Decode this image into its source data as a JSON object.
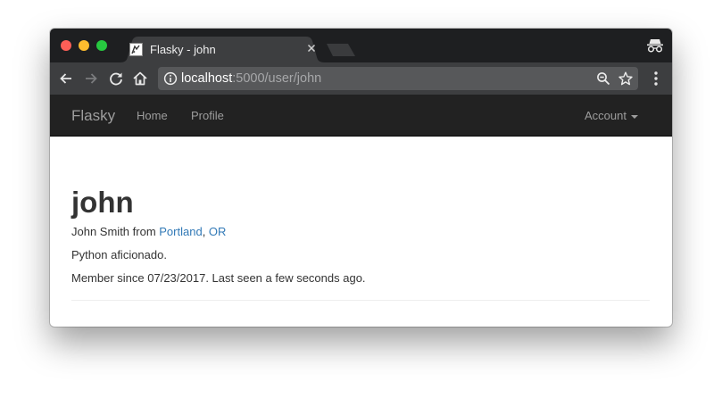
{
  "browser": {
    "tab_title": "Flasky - john",
    "url_host": "localhost",
    "url_rest": ":5000/user/john",
    "icons": [
      "favicon-icon",
      "tab-close-icon",
      "new-tab-icon",
      "incognito-icon",
      "back-icon",
      "forward-icon",
      "reload-icon",
      "home-icon",
      "info-icon",
      "zoom-icon",
      "bookmark-star-icon",
      "menu-icon"
    ]
  },
  "navbar": {
    "brand": "Flasky",
    "items": [
      "Home",
      "Profile"
    ],
    "account_label": "Account"
  },
  "profile": {
    "username": "john",
    "name_prefix": "John Smith from ",
    "city": "Portland",
    "separator": ", ",
    "state": "OR",
    "about": "Python aficionado.",
    "member_since": "Member since 07/23/2017. Last seen a few seconds ago."
  },
  "colors": {
    "navbar_bg": "#222222",
    "link": "#337ab7",
    "tab_strip": "#1e1f21",
    "toolbar": "#3d3e40"
  }
}
